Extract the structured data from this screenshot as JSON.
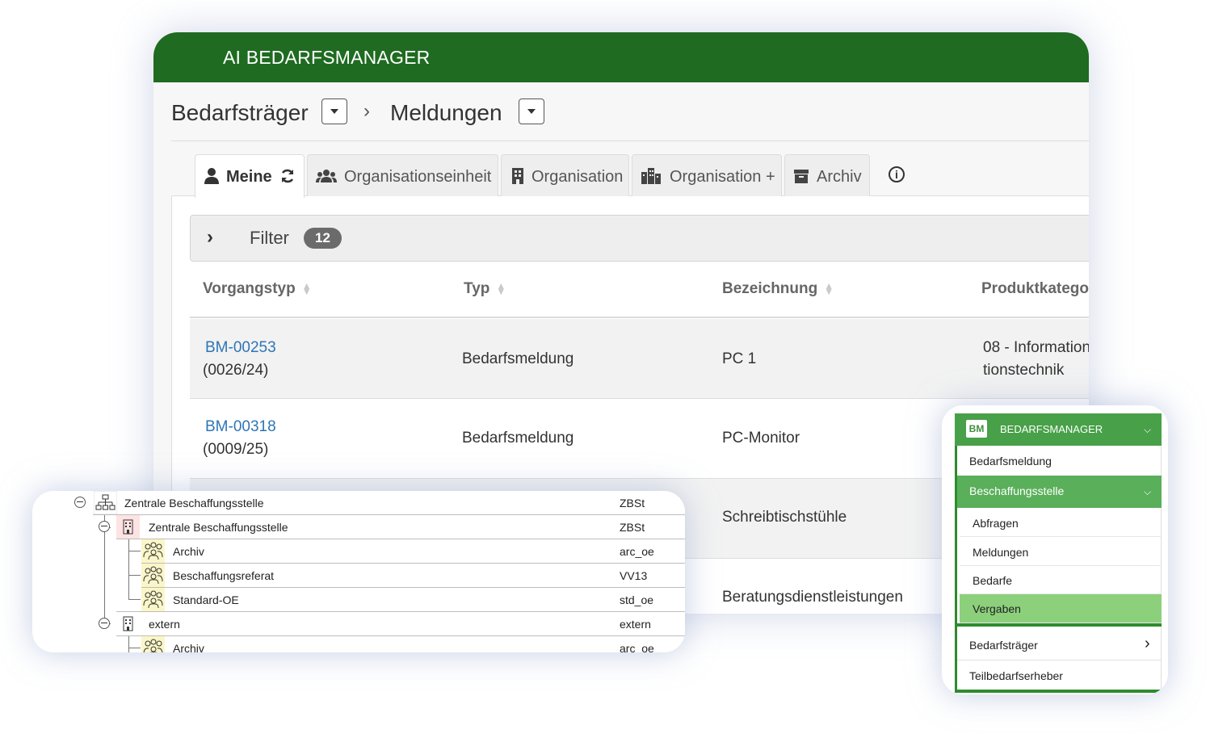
{
  "app": {
    "title": "AI BEDARFSMANAGER"
  },
  "breadcrumb": {
    "level1": "Bedarfsträger",
    "separator": "›",
    "level2": "Meldungen"
  },
  "tabs": [
    {
      "label": "Meine",
      "icon": "user-icon",
      "active": true
    },
    {
      "label": "Organisationseinheit",
      "icon": "users-icon"
    },
    {
      "label": "Organisation",
      "icon": "building-icon"
    },
    {
      "label": "Organisation +",
      "icon": "city-icon"
    },
    {
      "label": "Archiv",
      "icon": "archive-icon"
    }
  ],
  "filter": {
    "label": "Filter",
    "count": "12"
  },
  "table": {
    "columns": [
      "Vorgangstyp",
      "Typ",
      "Bezeichnung",
      "Produktkatego"
    ],
    "rows": [
      {
        "id": "BM-00253",
        "ref": "(0026/24)",
        "typ": "Bedarfsmeldung",
        "bezeichnung": "PC 1",
        "kategorie_line1": "08 - Information",
        "kategorie_line2": "tionstechnik"
      },
      {
        "id": "BM-00318",
        "ref": "(0009/25)",
        "typ": "Bedarfsmeldung",
        "bezeichnung": "PC-Monitor"
      },
      {
        "bezeichnung": "Schreibtischstühle"
      },
      {
        "bezeichnung": "Beratungsdienstleistungen"
      }
    ]
  },
  "tree": {
    "rows": [
      {
        "label": "Zentrale Beschaffungsstelle",
        "code": "ZBSt",
        "icon": "org-chart-icon"
      },
      {
        "label": "Zentrale Beschaffungsstelle",
        "code": "ZBSt",
        "icon": "building-icon"
      },
      {
        "label": "Archiv",
        "code": "arc_oe",
        "icon": "group-icon"
      },
      {
        "label": "Beschaffungsreferat",
        "code": "VV13",
        "icon": "group-icon"
      },
      {
        "label": "Standard-OE",
        "code": "std_oe",
        "icon": "group-icon"
      },
      {
        "label": "extern",
        "code": "extern",
        "icon": "building-icon"
      },
      {
        "label": "Archiv",
        "code": "arc_oe",
        "icon": "group-icon"
      }
    ]
  },
  "menu": {
    "logo": "BM",
    "header": "BEDARFSMANAGER",
    "items": {
      "bedarfsmeldung": "Bedarfsmeldung",
      "beschaffungsstelle": "Beschaffungsstelle",
      "abfragen": "Abfragen",
      "meldungen": "Meldungen",
      "bedarfe": "Bedarfe",
      "vergaben": "Vergaben",
      "bedarfstraeger": "Bedarfsträger",
      "teilbedarfserheber": "Teilbedarfserheber"
    },
    "colors": {
      "header": "#48a048",
      "section": "#5aaf5a",
      "active": "#8dd07c"
    }
  },
  "colors": {
    "app_header": "#1f6b21",
    "link": "#2e75b6",
    "badge": "#6b6b6b"
  }
}
